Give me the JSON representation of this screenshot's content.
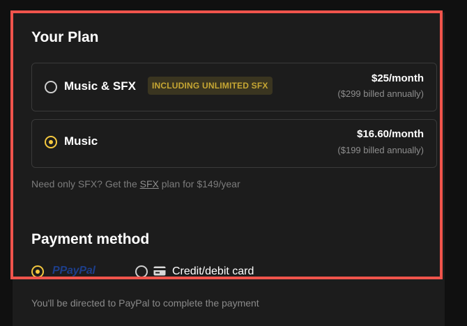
{
  "plan": {
    "title": "Your Plan",
    "options": [
      {
        "name": "Music & SFX",
        "badge": "INCLUDING UNLIMITED SFX",
        "price": "$25/month",
        "billed": "($299 billed annually)",
        "selected": false
      },
      {
        "name": "Music",
        "price": "$16.60/month",
        "billed": "($199 billed annually)",
        "selected": true
      }
    ],
    "hint": {
      "prefix": "Need only SFX? Get the ",
      "link": "SFX",
      "suffix": " plan for $149/year"
    }
  },
  "payment": {
    "title": "Payment method",
    "options": [
      {
        "name": "PayPal",
        "selected": true
      },
      {
        "name": "Credit/debit card",
        "selected": false
      }
    ],
    "note": "You'll be directed to PayPal to complete the payment"
  },
  "colors": {
    "accent": "#f4c83f",
    "highlight_border": "#f0544c",
    "panel_bg": "#1c1c1c"
  }
}
